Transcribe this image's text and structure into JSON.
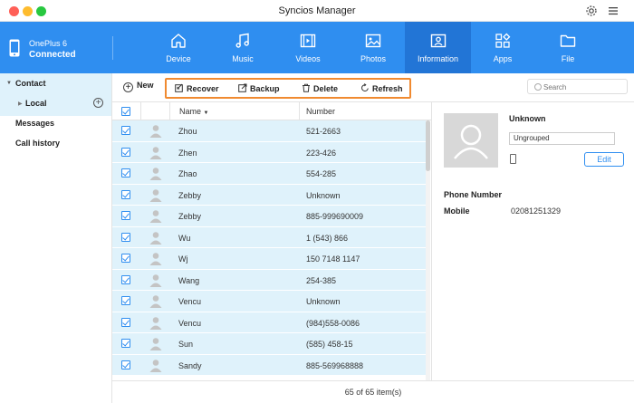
{
  "window": {
    "title": "Syncios Manager"
  },
  "device": {
    "name": "OnePlus 6",
    "status": "Connected"
  },
  "nav": {
    "tabs": [
      {
        "label": "Device",
        "icon": "home-icon"
      },
      {
        "label": "Music",
        "icon": "music-icon"
      },
      {
        "label": "Videos",
        "icon": "video-icon"
      },
      {
        "label": "Photos",
        "icon": "photo-icon"
      },
      {
        "label": "Information",
        "icon": "contact-card-icon",
        "active": true
      },
      {
        "label": "Apps",
        "icon": "apps-icon"
      },
      {
        "label": "File",
        "icon": "folder-icon"
      }
    ]
  },
  "sidebar": {
    "contact": "Contact",
    "local": "Local",
    "messages": "Messages",
    "call_history": "Call history"
  },
  "toolbar": {
    "new": "New",
    "recover": "Recover",
    "backup": "Backup",
    "delete": "Delete",
    "refresh": "Refresh",
    "search_placeholder": "Search"
  },
  "table": {
    "col_name": "Name",
    "col_number": "Number",
    "rows": [
      {
        "name": "Zhou",
        "number": "521-2663"
      },
      {
        "name": "Zhen",
        "number": "223-426"
      },
      {
        "name": "Zhao",
        "number": "554-285"
      },
      {
        "name": "Zebby",
        "number": "Unknown"
      },
      {
        "name": "Zebby",
        "number": "885-999690009"
      },
      {
        "name": "Wu",
        "number": "1 (543) 866"
      },
      {
        "name": "Wj",
        "number": "150 7148 1147"
      },
      {
        "name": "Wang",
        "number": "254-385"
      },
      {
        "name": "Vencu",
        "number": "Unknown"
      },
      {
        "name": "Vencu",
        "number": "(984)558-0086"
      },
      {
        "name": "Sun",
        "number": "(585) 458-15"
      },
      {
        "name": "Sandy",
        "number": "885-569968888"
      }
    ]
  },
  "detail": {
    "name": "Unknown",
    "group": "Ungrouped",
    "edit": "Edit",
    "phone_section": "Phone Number",
    "mobile_label": "Mobile",
    "mobile_value": "02081251329"
  },
  "status": {
    "count": "65 of 65 item(s)"
  },
  "colors": {
    "accent": "#2f8ef0",
    "active_tab": "#2275d6",
    "row_bg": "#dff2fb",
    "highlight": "#f08a30"
  }
}
